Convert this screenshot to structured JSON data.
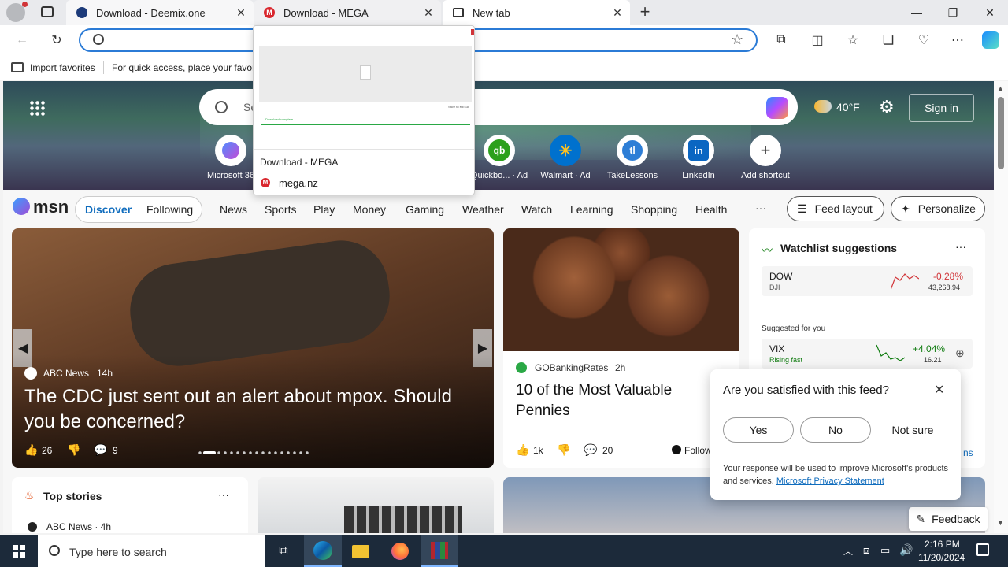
{
  "tabs": [
    {
      "title": "Download - Deemix.one"
    },
    {
      "title": "Download - MEGA"
    },
    {
      "title": "New tab"
    }
  ],
  "favbar": {
    "import_label": "Import favorites",
    "hint_text": "For quick access, place your favori"
  },
  "tooltip": {
    "page_title": "Download - MEGA",
    "domain": "mega.nz",
    "preview_text": "Download complete",
    "preview_button": "Save to MEGA"
  },
  "hero": {
    "search_placeholder": "Se",
    "weather_temp": "40°F",
    "sign_in": "Sign in",
    "shortcuts": [
      {
        "label": "Microsoft 36",
        "icon": "microsoft-365-icon"
      },
      {
        "label": "Quickbo... · Ad",
        "icon": "quickbooks-icon"
      },
      {
        "label": "Walmart · Ad",
        "icon": "walmart-icon"
      },
      {
        "label": "TakeLessons",
        "icon": "takelessons-icon"
      },
      {
        "label": "LinkedIn",
        "icon": "linkedin-icon"
      },
      {
        "label": "Add shortcut",
        "icon": "plus-icon"
      }
    ]
  },
  "msn": {
    "logo": "msn",
    "discover": "Discover",
    "following": "Following",
    "nav": [
      "News",
      "Sports",
      "Play",
      "Money",
      "Gaming",
      "Weather",
      "Watch",
      "Learning",
      "Shopping",
      "Health"
    ],
    "more": "···",
    "feed_layout": "Feed layout",
    "personalize": "Personalize"
  },
  "main_story": {
    "source": "ABC News",
    "age": "14h",
    "headline": "The CDC just sent out an alert about mpox. Should you be concerned?",
    "likes": "26",
    "comments": "9"
  },
  "second_story": {
    "source": "GOBankingRates",
    "age": "2h",
    "headline": "10 of the Most Valuable Pennies",
    "likes": "1k",
    "comments": "20",
    "follow": "Follow"
  },
  "watchlist": {
    "title": "Watchlist suggestions",
    "more": "···",
    "dow_name": "DOW",
    "dow_sub": "DJI",
    "dow_change": "-0.28%",
    "dow_value": "43,268.94",
    "suggested": "Suggested for you",
    "vix_name": "VIX",
    "vix_sub": "Rising fast",
    "vix_change": "+4.04%",
    "vix_value": "16.21",
    "more_link": "ns"
  },
  "top_stories": {
    "title": "Top stories",
    "more": "···",
    "source": "ABC News · 4h"
  },
  "survey": {
    "question": "Are you satisfied with this feed?",
    "yes": "Yes",
    "no": "No",
    "not_sure": "Not sure",
    "note": "Your response will be used to improve Microsoft's products and services.",
    "link": "Microsoft Privacy Statement"
  },
  "feedback": "Feedback",
  "taskbar": {
    "search_placeholder": "Type here to search",
    "time": "2:16 PM",
    "date": "11/20/2024"
  },
  "colors": {
    "accent": "#0f6cbd",
    "taskbar": "#1c2a3a",
    "negative": "#d13438",
    "positive": "#107c10"
  }
}
